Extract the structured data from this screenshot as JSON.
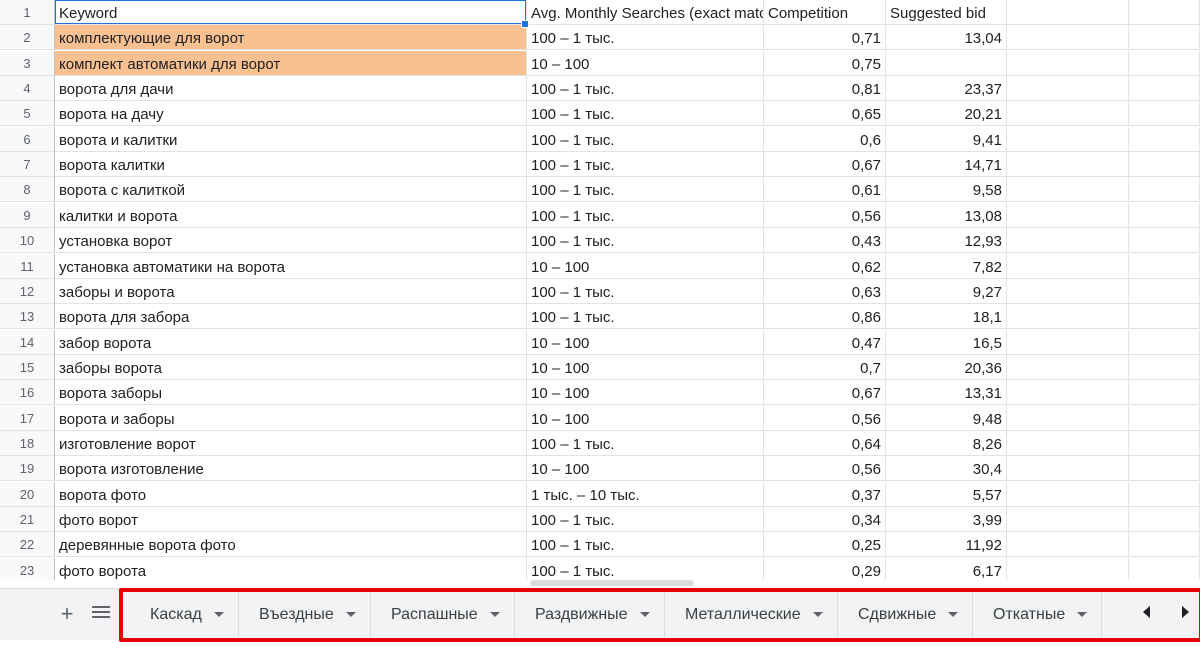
{
  "sheet": {
    "header": [
      "Keyword",
      "Avg. Monthly Searches (exact match only)",
      "Competition",
      "Suggested bid"
    ],
    "rows": [
      [
        "комплектующие для ворот",
        "100 – 1 тыс.",
        "0,71",
        "13,04"
      ],
      [
        "комплект автоматики для ворот",
        "10 – 100",
        "0,75",
        ""
      ],
      [
        "ворота для дачи",
        "100 – 1 тыс.",
        "0,81",
        "23,37"
      ],
      [
        "ворота на дачу",
        "100 – 1 тыс.",
        "0,65",
        "20,21"
      ],
      [
        "ворота и калитки",
        "100 – 1 тыс.",
        "0,6",
        "9,41"
      ],
      [
        "ворота калитки",
        "100 – 1 тыс.",
        "0,67",
        "14,71"
      ],
      [
        "ворота с калиткой",
        "100 – 1 тыс.",
        "0,61",
        "9,58"
      ],
      [
        "калитки и ворота",
        "100 – 1 тыс.",
        "0,56",
        "13,08"
      ],
      [
        "установка ворот",
        "100 – 1 тыс.",
        "0,43",
        "12,93"
      ],
      [
        "установка автоматики на ворота",
        "10 – 100",
        "0,62",
        "7,82"
      ],
      [
        "заборы и ворота",
        "100 – 1 тыс.",
        "0,63",
        "9,27"
      ],
      [
        "ворота для забора",
        "100 – 1 тыс.",
        "0,86",
        "18,1"
      ],
      [
        "забор ворота",
        "10 – 100",
        "0,47",
        "16,5"
      ],
      [
        "заборы ворота",
        "10 – 100",
        "0,7",
        "20,36"
      ],
      [
        "ворота заборы",
        "10 – 100",
        "0,67",
        "13,31"
      ],
      [
        "ворота и заборы",
        "10 – 100",
        "0,56",
        "9,48"
      ],
      [
        "изготовление ворот",
        "100 – 1 тыс.",
        "0,64",
        "8,26"
      ],
      [
        "ворота изготовление",
        "10 – 100",
        "0,56",
        "30,4"
      ],
      [
        "ворота фото",
        "1 тыс. – 10 тыс.",
        "0,37",
        "5,57"
      ],
      [
        "фото ворот",
        "100 – 1 тыс.",
        "0,34",
        "3,99"
      ],
      [
        "деревянные ворота фото",
        "100 – 1 тыс.",
        "0,25",
        "11,92"
      ],
      [
        "фото ворота",
        "100 – 1 тыс.",
        "0,29",
        "6,17"
      ]
    ],
    "highlight_color": "#f9c091",
    "highlighted_rows": [
      2,
      3
    ]
  },
  "tabbar": {
    "add_icon": "plus-icon",
    "list_icon": "menu-lines-icon",
    "tabs": [
      "Каскад",
      "Въездные",
      "Распашные",
      "Раздвижные",
      "Металлические",
      "Сдвижные",
      "Откатные"
    ],
    "nav_left_icon": "chevron-left-icon",
    "nav_right_icon": "chevron-right-icon"
  },
  "annotation": {
    "box_color": "#e60000"
  }
}
